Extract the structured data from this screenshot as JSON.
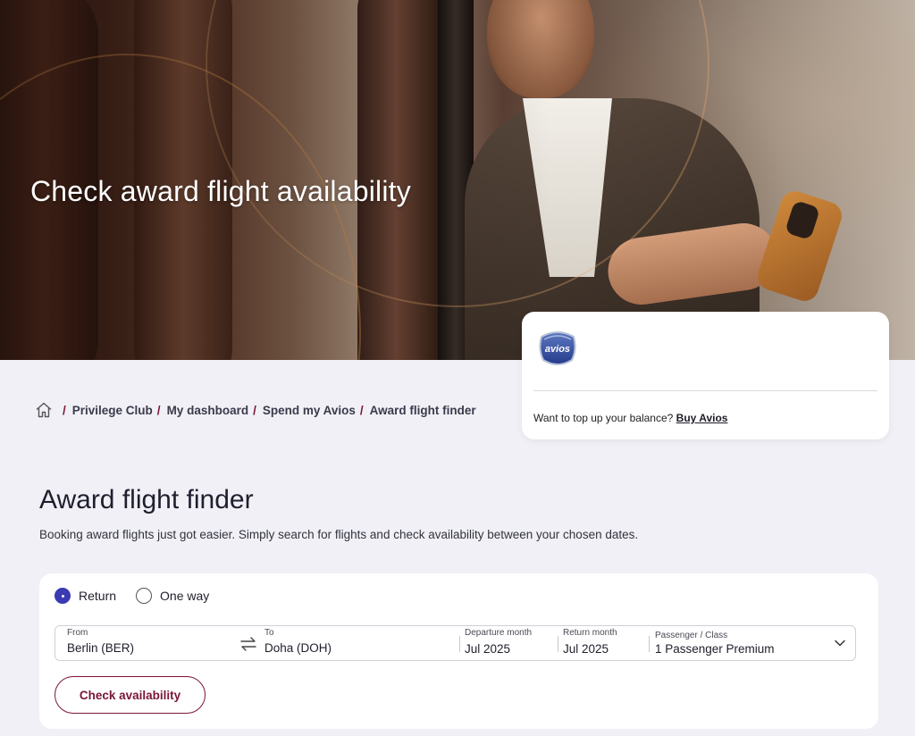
{
  "hero": {
    "title": "Check award flight availability"
  },
  "avios_card": {
    "logo_text": "avios",
    "topup_text": "Want to top up your balance?",
    "buy_link": "Buy Avios"
  },
  "breadcrumb": {
    "home_icon": "home-icon",
    "items": [
      {
        "label": "Privilege Club"
      },
      {
        "label": "My dashboard"
      },
      {
        "label": "Spend my Avios"
      },
      {
        "label": "Award flight finder"
      }
    ]
  },
  "page": {
    "title": "Award flight finder",
    "description": "Booking award flights just got easier. Simply search for flights and check availability between your chosen dates."
  },
  "search": {
    "trip_type": {
      "selected": "Return",
      "options": [
        {
          "label": "Return",
          "selected": true
        },
        {
          "label": "One way",
          "selected": false
        }
      ]
    },
    "from": {
      "label": "From",
      "value": "Berlin (BER)"
    },
    "to": {
      "label": "To",
      "value": "Doha (DOH)"
    },
    "departure_month": {
      "label": "Departure month",
      "value": "Jul 2025"
    },
    "return_month": {
      "label": "Return month",
      "value": "Jul 2025"
    },
    "passenger_class": {
      "label": "Passenger / Class",
      "value": "1 Passenger Premium"
    },
    "submit_label": "Check availability"
  },
  "colors": {
    "brand": "#7a1537",
    "radio_selected": "#3b3bb3",
    "page_bg": "#f0f0f6"
  }
}
